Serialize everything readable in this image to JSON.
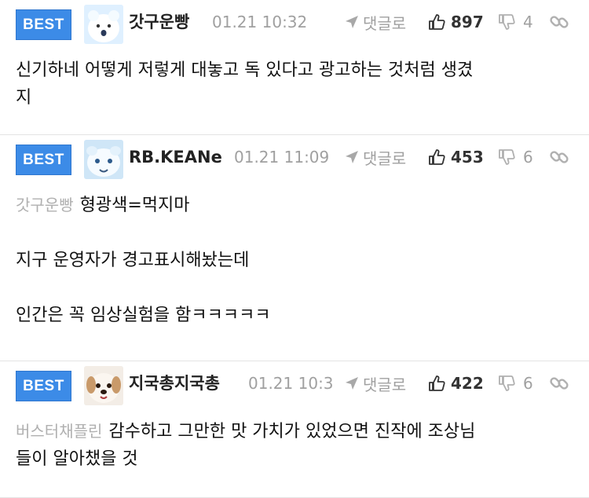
{
  "comments": [
    {
      "badge": "BEST",
      "nickname": "갓구운빵",
      "time": "01.21 10:32",
      "reply_label": "댓글로",
      "likes": "897",
      "dislikes": "4",
      "mention": "",
      "lines": [
        "신기하네 어떻게 저렇게 대놓고 독 있다고 광고하는 것처럼 생겼",
        "지"
      ]
    },
    {
      "badge": "BEST",
      "nickname": "RB.KEANe",
      "time": "01.21 11:09",
      "reply_label": "댓글로",
      "likes": "453",
      "dislikes": "6",
      "mention": "갓구운빵",
      "lines": [
        "형광색=먹지마",
        "",
        "지구 운영자가 경고표시해놨는데",
        "",
        "인간은 꼭 임상실험을 함ㅋㅋㅋㅋㅋ"
      ]
    },
    {
      "badge": "BEST",
      "nickname": "지국총지국총",
      "time": "01.21 10:3",
      "reply_label": "댓글로",
      "likes": "422",
      "dislikes": "6",
      "mention": "버스터채플린",
      "lines": [
        "감수하고 그만한 맛 가치가 있었으면 진작에 조상님",
        "들이 알아챘을 것"
      ]
    }
  ],
  "colors": {
    "badge": "#3c8be7",
    "muted": "#a0a0a0",
    "divider": "#e4e4e4"
  },
  "icons": [
    "send-arrow-icon",
    "thumbs-up-icon",
    "thumbs-down-icon",
    "link-icon"
  ]
}
